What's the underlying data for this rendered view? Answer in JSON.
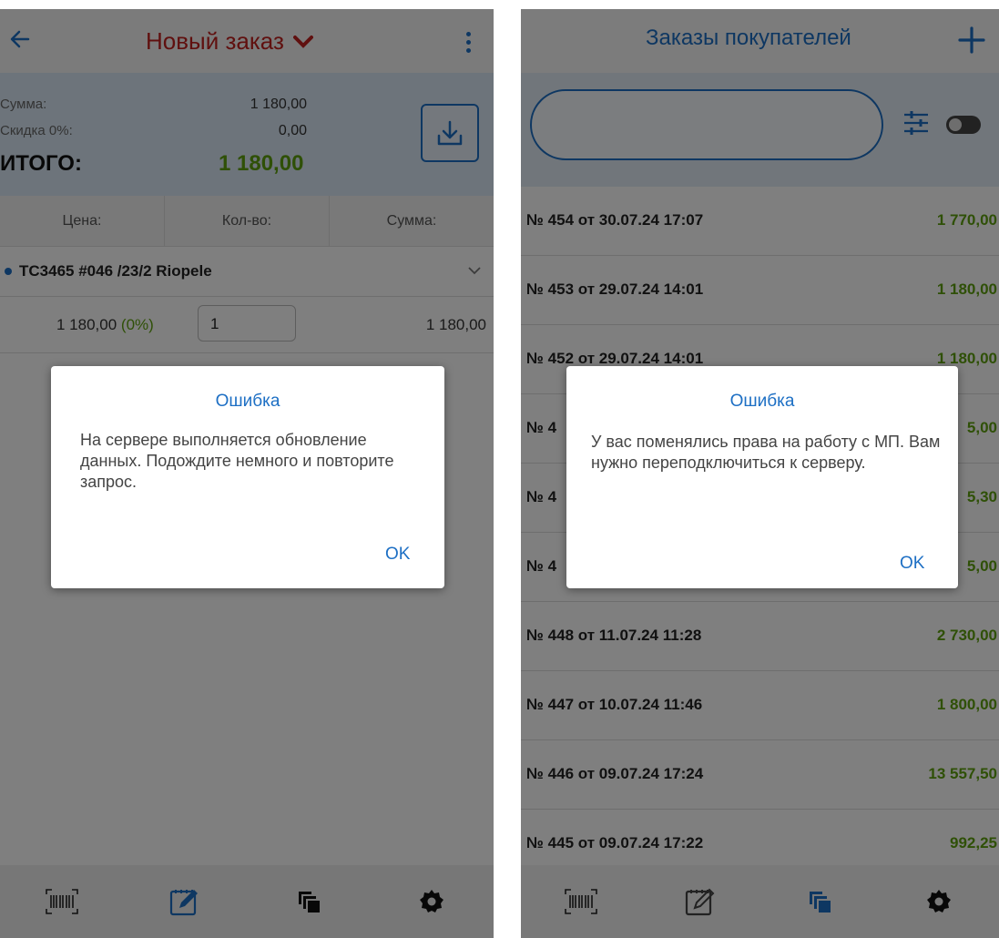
{
  "left": {
    "header": {
      "title": "Новый заказ"
    },
    "totals": {
      "sum_label": "Сумма:",
      "sum_value": "1 180,00",
      "discount_label": "Скидка 0%:",
      "discount_value": "0,00",
      "total_label": "ИТОГО:",
      "total_value": "1 180,00"
    },
    "columns": [
      "Цена:",
      "Кол-во:",
      "Сумма:"
    ],
    "item": {
      "name": "ТС3465 #046 /23/2 Riopele",
      "price": "1 180,00",
      "discount": "(0%)",
      "quantity": "1",
      "sum": "1 180,00"
    },
    "dialog": {
      "title": "Ошибка",
      "message": "На сервере выполняется обновление данных. Подождите немного и повторите запрос.",
      "ok": "OK"
    }
  },
  "right": {
    "header": {
      "title": "Заказы покупателей"
    },
    "search": {
      "placeholder": ""
    },
    "orders": [
      {
        "title": "№ 454 от 30.07.24 17:07",
        "sum": "1 770,00"
      },
      {
        "title": "№ 453 от 29.07.24 14:01",
        "sum": "1 180,00"
      },
      {
        "title": "№ 452 от 29.07.24 14:01",
        "sum": "1 180,00"
      },
      {
        "title": "№ 4",
        "sum": "5,00"
      },
      {
        "title": "№ 4",
        "sum": "5,30"
      },
      {
        "title": "№ 4",
        "sum": "5,00"
      },
      {
        "title": "№ 448 от 11.07.24 11:28",
        "sum": "2 730,00"
      },
      {
        "title": "№ 447 от 10.07.24 11:46",
        "sum": "1 800,00"
      },
      {
        "title": "№ 446 от 09.07.24 17:24",
        "sum": "13 557,50"
      },
      {
        "title": "№ 445 от 09.07.24 17:22",
        "sum": "992,25"
      }
    ],
    "dialog": {
      "title": "Ошибка",
      "message": "У вас поменялись права на работу с МП. Вам нужно переподключиться к серверу.",
      "ok": "OK"
    }
  },
  "colors": {
    "accent": "#1d6fc4",
    "title_red": "#c0201e",
    "money_green": "#5ea10e",
    "totals_bg": "#dbe9f6"
  },
  "icons": [
    "back-arrow-icon",
    "chevron-down-icon",
    "more-vert-icon",
    "download-icon",
    "plus-icon",
    "filter-icon",
    "toggle-icon",
    "barcode-icon",
    "edit-icon",
    "copy-icon",
    "settings-icon"
  ]
}
